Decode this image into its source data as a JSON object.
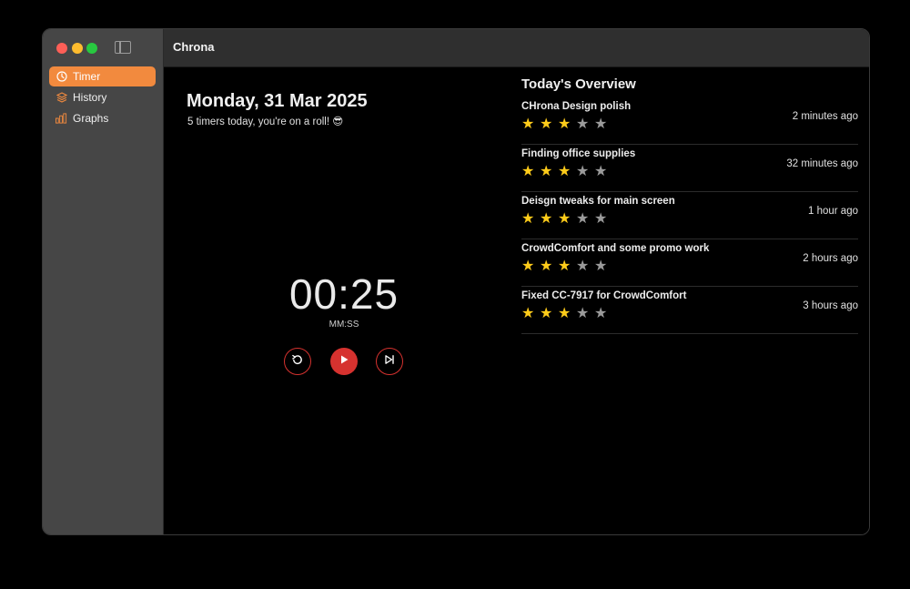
{
  "window": {
    "title": "Chrona"
  },
  "sidebar": {
    "items": [
      {
        "label": "Timer",
        "icon": "timer-icon",
        "active": true
      },
      {
        "label": "History",
        "icon": "layers-icon",
        "active": false
      },
      {
        "label": "Graphs",
        "icon": "bar-chart-icon",
        "active": false
      }
    ]
  },
  "main": {
    "date": "Monday, 31 Mar 2025",
    "subtitle": "5 timers today, you're on a roll! 😎",
    "timer": {
      "value": "00:25",
      "unit": "MM:SS"
    },
    "controls": [
      "reset-icon",
      "play-icon",
      "skip-icon"
    ]
  },
  "overview": {
    "title": "Today's Overview",
    "items": [
      {
        "name": "CHrona Design polish",
        "time": "2 minutes ago",
        "rating": 3,
        "max": 5
      },
      {
        "name": "Finding office supplies",
        "time": "32 minutes ago",
        "rating": 3,
        "max": 5
      },
      {
        "name": "Deisgn tweaks for main screen",
        "time": "1 hour ago",
        "rating": 3,
        "max": 5
      },
      {
        "name": "CrowdComfort and some promo work",
        "time": "2 hours ago",
        "rating": 3,
        "max": 5
      },
      {
        "name": "Fixed CC-7917 for CrowdComfort",
        "time": "3 hours ago",
        "rating": 3,
        "max": 5
      }
    ]
  },
  "colors": {
    "accent": "#f28a3e",
    "control": "#d6322f",
    "star_on": "#ffcc1a",
    "star_off": "#9a9a9a"
  }
}
